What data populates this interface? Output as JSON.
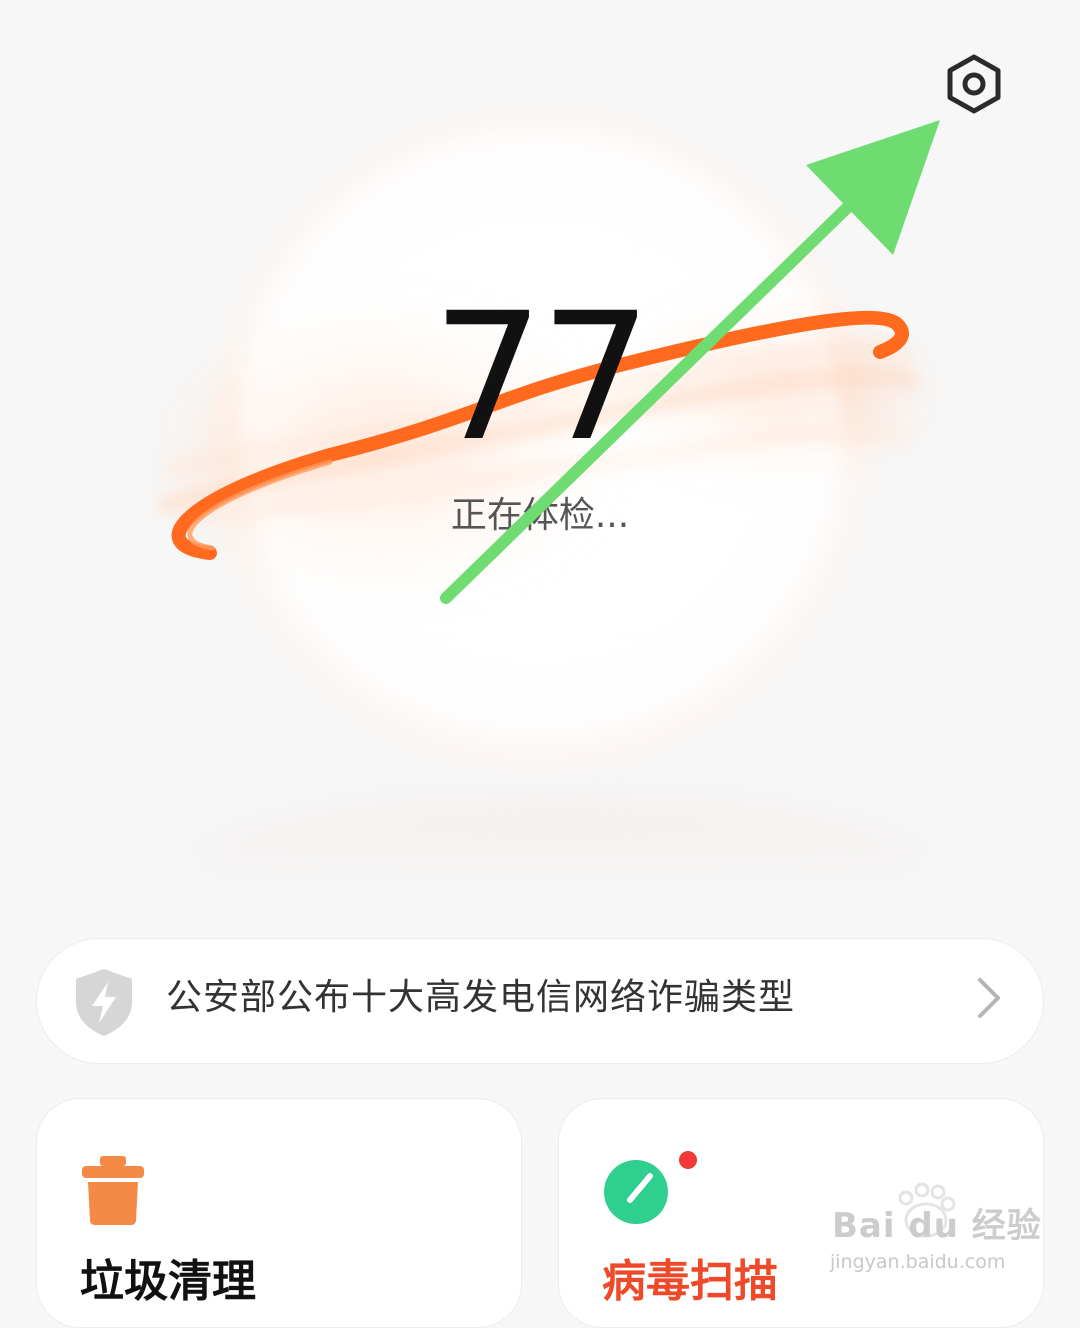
{
  "header": {
    "settings_icon": "settings-hexagon-icon"
  },
  "checkup": {
    "score": "77",
    "status": "正在体检..."
  },
  "notice": {
    "icon": "shield-lightning-icon",
    "text": "公安部公布十大高发电信网络诈骗类型",
    "chevron": "chevron-right-icon"
  },
  "cards": [
    {
      "title": "垃圾清理",
      "icon": "trash-bin-icon"
    },
    {
      "title": "病毒扫描",
      "icon": "scan-dial-icon",
      "has_badge": true
    }
  ],
  "annotation": {
    "arrow_color": "#6fdc72"
  },
  "watermark": {
    "brand": "Bai du 经验",
    "url": "jingyan.baidu.com"
  },
  "colors": {
    "accent_orange": "#ff6a1f",
    "virus_green": "#2ecf8f",
    "virus_title": "#ee4a2a",
    "badge_red": "#f03a3a"
  }
}
